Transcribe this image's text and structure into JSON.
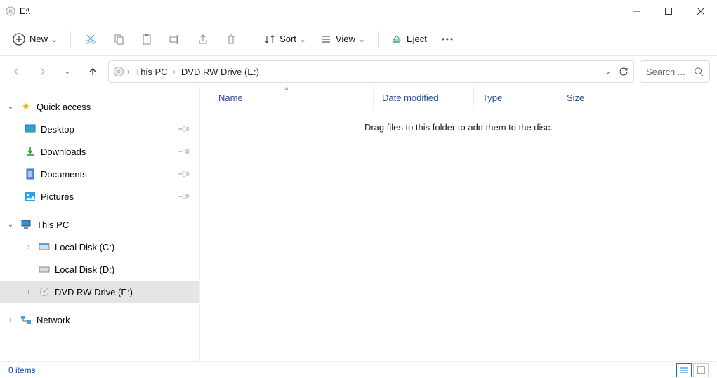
{
  "window": {
    "title": "E:\\"
  },
  "toolbar": {
    "new": "New",
    "sort": "Sort",
    "view": "View",
    "eject": "Eject"
  },
  "breadcrumb": {
    "root": "This PC",
    "current": "DVD RW Drive (E:)"
  },
  "search": {
    "placeholder": "Search ..."
  },
  "sidebar": {
    "quick_access": "Quick access",
    "desktop": "Desktop",
    "downloads": "Downloads",
    "documents": "Documents",
    "pictures": "Pictures",
    "this_pc": "This PC",
    "local_c": "Local Disk (C:)",
    "local_d": "Local Disk (D:)",
    "dvd_e": "DVD RW Drive (E:)",
    "network": "Network"
  },
  "columns": {
    "name": "Name",
    "date": "Date modified",
    "type": "Type",
    "size": "Size"
  },
  "content": {
    "empty_message": "Drag files to this folder to add them to the disc."
  },
  "status": {
    "items": "0 items"
  }
}
